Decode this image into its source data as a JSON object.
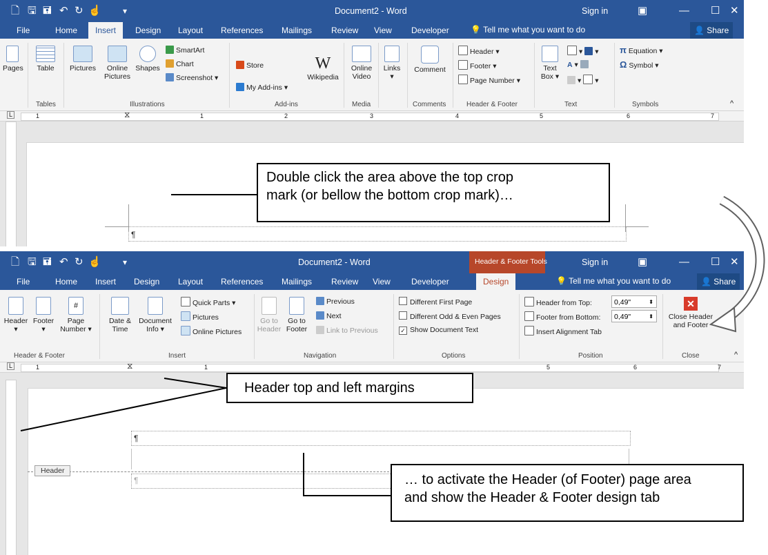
{
  "app": {
    "title_top": "Document2  -  Word",
    "title_bottom": "Document2  -  Word",
    "contextual_tab": "Header & Footer Tools",
    "sign_in": "Sign in",
    "tell_me": "Tell me what you want to do",
    "share": "Share"
  },
  "tabs_top": [
    "File",
    "Home",
    "Insert",
    "Design",
    "Layout",
    "References",
    "Mailings",
    "Review",
    "View",
    "Developer"
  ],
  "tabs_bottom": [
    "File",
    "Home",
    "Insert",
    "Design",
    "Layout",
    "References",
    "Mailings",
    "Review",
    "View",
    "Developer",
    "Design"
  ],
  "insert_ribbon": {
    "pages": "Pages",
    "table": "Table",
    "pictures": "Pictures",
    "online_pictures_1": "Online",
    "online_pictures_2": "Pictures",
    "shapes": "Shapes",
    "smartart": "SmartArt",
    "chart": "Chart",
    "screenshot": "Screenshot",
    "store": "Store",
    "my_addins": "My Add-ins",
    "wikipedia": "Wikipedia",
    "online_video_1": "Online",
    "online_video_2": "Video",
    "links": "Links",
    "comment": "Comment",
    "header": "Header",
    "footer": "Footer",
    "page_number": "Page Number",
    "text_box_1": "Text",
    "text_box_2": "Box",
    "equation": "Equation",
    "symbol": "Symbol",
    "groups": {
      "tables": "Tables",
      "illustrations": "Illustrations",
      "addins": "Add-ins",
      "media": "Media",
      "comments": "Comments",
      "header_footer": "Header & Footer",
      "text": "Text",
      "symbols": "Symbols"
    }
  },
  "design_ribbon": {
    "header": "Header",
    "footer": "Footer",
    "page_number_1": "Page",
    "page_number_2": "Number",
    "date_time_1": "Date &",
    "date_time_2": "Time",
    "doc_info_1": "Document",
    "doc_info_2": "Info",
    "quick_parts": "Quick Parts",
    "pictures": "Pictures",
    "online_pictures": "Online Pictures",
    "goto_header_1": "Go to",
    "goto_header_2": "Header",
    "goto_footer_1": "Go to",
    "goto_footer_2": "Footer",
    "previous": "Previous",
    "next": "Next",
    "link_to_previous": "Link to Previous",
    "diff_first": "Different First Page",
    "diff_odd_even": "Different Odd & Even Pages",
    "show_doc_text": "Show Document Text",
    "header_from_top": "Header from Top:",
    "footer_from_bottom": "Footer from Bottom:",
    "insert_alignment_tab": "Insert Alignment Tab",
    "header_top_value": "0,49\"",
    "footer_bottom_value": "0,49\"",
    "close_1": "Close Header",
    "close_2": "and Footer",
    "groups": {
      "header_footer": "Header & Footer",
      "insert": "Insert",
      "navigation": "Navigation",
      "options": "Options",
      "position": "Position",
      "close": "Close"
    }
  },
  "ruler_numbers": [
    "1",
    "2",
    "3",
    "4",
    "5",
    "6",
    "7"
  ],
  "document": {
    "pilcrow": "¶",
    "header_tag": "Header"
  },
  "callouts": {
    "double_click_1": "Double click the area above the top crop",
    "double_click_2": "mark (or bellow the bottom crop mark)…",
    "margins": "Header top and left margins",
    "activate_1": "… to activate the Header (of Footer) page area",
    "activate_2": "and show the Header & Footer design tab"
  },
  "colors": {
    "word_blue": "#2b579a",
    "contextual": "#c0504d",
    "ribbon_bg": "#f3f3f3",
    "close_red": "#d83b2a"
  }
}
